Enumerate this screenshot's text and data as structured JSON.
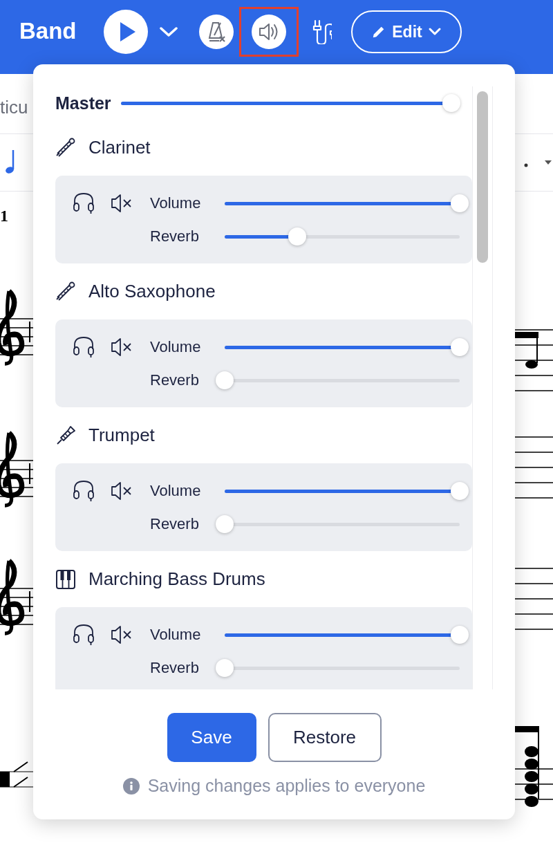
{
  "header": {
    "title": "Band",
    "tools": [
      {
        "kind": "play",
        "highlighted": false
      },
      {
        "kind": "dropdown",
        "highlighted": false
      },
      {
        "kind": "metronome",
        "highlighted": false
      },
      {
        "kind": "mixer",
        "highlighted": true
      },
      {
        "kind": "cable",
        "highlighted": false
      }
    ],
    "edit_button": {
      "label": "Edit"
    }
  },
  "subheader": {
    "text": "ticu"
  },
  "score": {
    "measure_number": "1"
  },
  "mixer": {
    "master": {
      "label": "Master",
      "level": 1
    },
    "instruments": [
      {
        "name": "Clarinet",
        "kind": "woodwind",
        "sliders": [
          {
            "label": "Volume",
            "level": 1
          },
          {
            "label": "Reverb",
            "level": 0.31
          }
        ]
      },
      {
        "name": "Alto Saxophone",
        "kind": "woodwind",
        "sliders": [
          {
            "label": "Volume",
            "level": 1
          },
          {
            "label": "Reverb",
            "level": 0
          }
        ]
      },
      {
        "name": "Trumpet",
        "kind": "brass",
        "sliders": [
          {
            "label": "Volume",
            "level": 1
          },
          {
            "label": "Reverb",
            "level": 0
          }
        ]
      },
      {
        "name": "Marching Bass Drums",
        "kind": "keyboard",
        "sliders": [
          {
            "label": "Volume",
            "level": 1
          },
          {
            "label": "Reverb",
            "level": 0
          }
        ]
      }
    ],
    "buttons": [
      {
        "label": "Save",
        "kind": "primary"
      },
      {
        "label": "Restore",
        "kind": "secondary"
      }
    ],
    "note": "Saving changes applies to everyone"
  }
}
